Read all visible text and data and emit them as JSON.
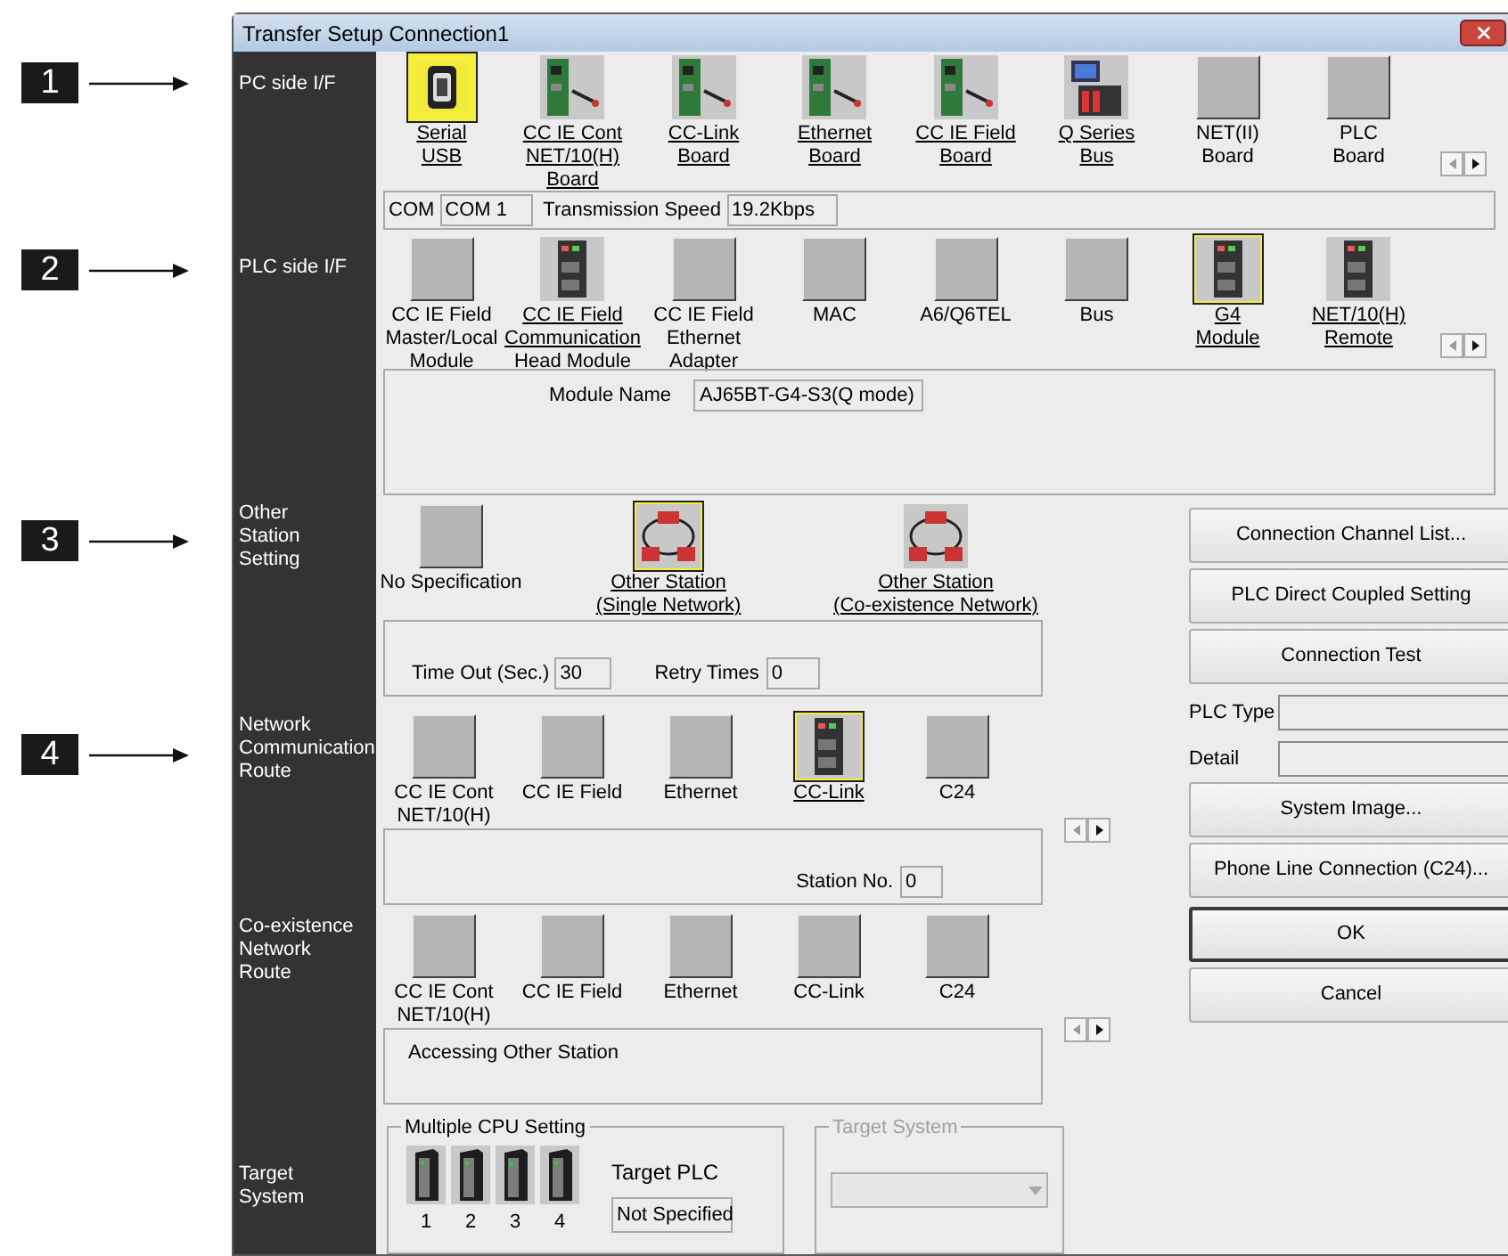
{
  "window": {
    "title": "Transfer Setup Connection1"
  },
  "callouts": [
    "1",
    "2",
    "3",
    "4"
  ],
  "pc_side": {
    "label": "PC side I/F",
    "items": [
      {
        "label": "Serial\nUSB",
        "kind": "usb",
        "selected": true
      },
      {
        "label": "CC IE Cont\nNET/10(H)\nBoard",
        "kind": "board",
        "selected": false
      },
      {
        "label": "CC-Link\nBoard",
        "kind": "board",
        "selected": false
      },
      {
        "label": "Ethernet\nBoard",
        "kind": "board",
        "selected": false
      },
      {
        "label": "CC IE Field\nBoard",
        "kind": "board",
        "selected": false
      },
      {
        "label": "Q Series\nBus",
        "kind": "computer",
        "selected": false
      },
      {
        "label": "NET(II)\nBoard",
        "kind": "blank",
        "selected": false
      },
      {
        "label": "PLC\nBoard",
        "kind": "blank",
        "selected": false
      }
    ],
    "com": {
      "label": "COM",
      "value": "COM 1"
    },
    "speed": {
      "label": "Transmission Speed",
      "value": "19.2Kbps"
    }
  },
  "plc_side": {
    "label": "PLC side I/F",
    "items": [
      {
        "label": "CC IE Field\nMaster/Local\nModule",
        "kind": "blank",
        "selected": false
      },
      {
        "label": "CC IE Field\nCommunication\nHead Module",
        "kind": "module",
        "selected": false
      },
      {
        "label": "CC IE Field\nEthernet\nAdapter",
        "kind": "blank",
        "selected": false
      },
      {
        "label": "MAC",
        "kind": "blank",
        "selected": false
      },
      {
        "label": "A6/Q6TEL",
        "kind": "blank",
        "selected": false
      },
      {
        "label": "Bus",
        "kind": "blank",
        "selected": false
      },
      {
        "label": "G4\nModule",
        "kind": "module",
        "selected": true
      },
      {
        "label": "NET/10(H)\nRemote",
        "kind": "module",
        "selected": false
      }
    ],
    "module_name": {
      "label": "Module Name",
      "value": "AJ65BT-G4-S3(Q mode)"
    }
  },
  "other_station": {
    "label": "Other\nStation\nSetting",
    "items": [
      {
        "label": "No Specification",
        "kind": "blank",
        "selected": false
      },
      {
        "label": "Other Station\n(Single Network)",
        "kind": "network",
        "selected": true
      },
      {
        "label": "Other Station\n(Co-existence Network)",
        "kind": "network",
        "selected": false
      }
    ],
    "timeout": {
      "label": "Time Out (Sec.)",
      "value": "30"
    },
    "retry": {
      "label": "Retry Times",
      "value": "0"
    }
  },
  "network_route": {
    "label": "Network\nCommunication\nRoute",
    "items": [
      {
        "label": "CC IE Cont\nNET/10(H)",
        "kind": "blank",
        "selected": false
      },
      {
        "label": "CC IE Field",
        "kind": "blank",
        "selected": false
      },
      {
        "label": "Ethernet",
        "kind": "blank",
        "selected": false
      },
      {
        "label": "CC-Link",
        "kind": "module",
        "selected": true
      },
      {
        "label": "C24",
        "kind": "blank",
        "selected": false
      }
    ],
    "station_no": {
      "label": "Station No.",
      "value": "0"
    }
  },
  "coexistence_route": {
    "label": "Co-existence\nNetwork\nRoute",
    "items": [
      {
        "label": "CC IE Cont\nNET/10(H)",
        "kind": "blank",
        "selected": false
      },
      {
        "label": "CC IE Field",
        "kind": "blank",
        "selected": false
      },
      {
        "label": "Ethernet",
        "kind": "blank",
        "selected": false
      },
      {
        "label": "CC-Link",
        "kind": "blank",
        "selected": false
      },
      {
        "label": "C24",
        "kind": "blank",
        "selected": false
      }
    ],
    "note": "Accessing Other Station"
  },
  "target_system": {
    "label": "Target\nSystem",
    "multiple_cpu": {
      "title": "Multiple CPU Setting",
      "cpus": [
        "1",
        "2",
        "3",
        "4"
      ],
      "target_plc_label": "Target PLC",
      "target_plc_value": "Not Specified"
    },
    "system_group": {
      "title": "Target System",
      "disabled": true
    }
  },
  "side_controls": [
    {
      "kind": "button",
      "label": "Connection Channel List...",
      "default": false
    },
    {
      "kind": "button",
      "label": "PLC Direct Coupled Setting",
      "default": false
    },
    {
      "kind": "button",
      "label": "Connection Test",
      "default": false
    },
    {
      "kind": "field",
      "label": "PLC Type"
    },
    {
      "kind": "field",
      "label": "Detail"
    },
    {
      "kind": "button",
      "label": "System Image...",
      "default": false
    },
    {
      "kind": "button",
      "label": "Phone Line Connection (C24)...",
      "default": false
    },
    {
      "kind": "button",
      "label": "OK",
      "default": true
    },
    {
      "kind": "button",
      "label": "Cancel",
      "default": false
    }
  ]
}
